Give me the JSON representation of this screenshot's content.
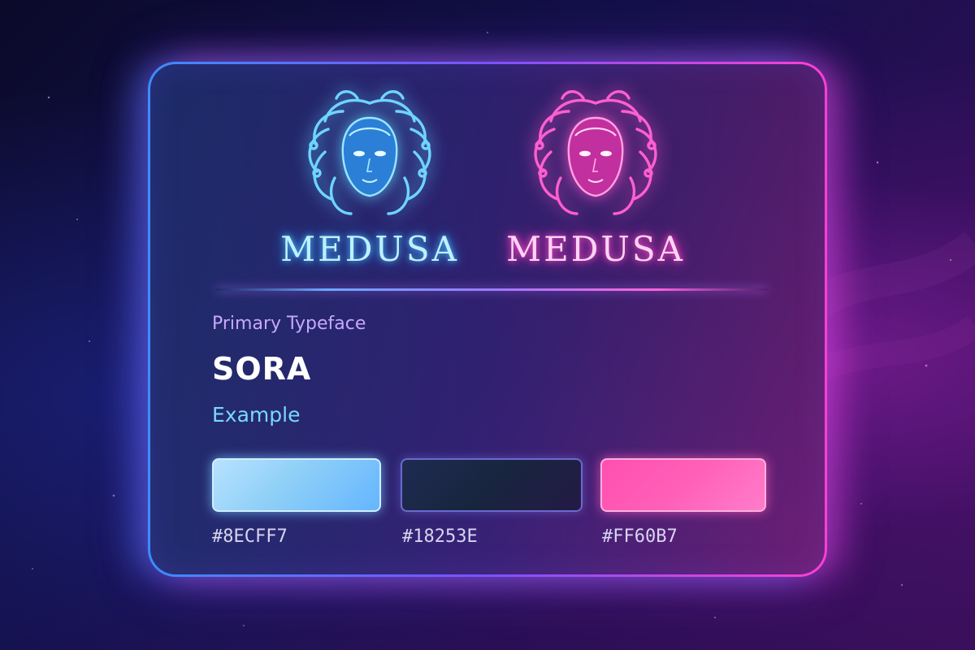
{
  "logos": [
    {
      "wordmark": "MEDUSA",
      "icon": "medusa-head-icon",
      "color": "#8ECFF7"
    },
    {
      "wordmark": "MEDUSA",
      "icon": "medusa-head-icon",
      "color": "#FF60B7"
    }
  ],
  "typography": {
    "label": "Primary Typeface",
    "name": "SORA",
    "example": "Example"
  },
  "palette": [
    {
      "hex": "#8ECFF7",
      "color": "#8ECFF7"
    },
    {
      "hex": "#18253E",
      "color": "#18253E"
    },
    {
      "hex": "#FF60B7",
      "color": "#FF60B7"
    }
  ]
}
